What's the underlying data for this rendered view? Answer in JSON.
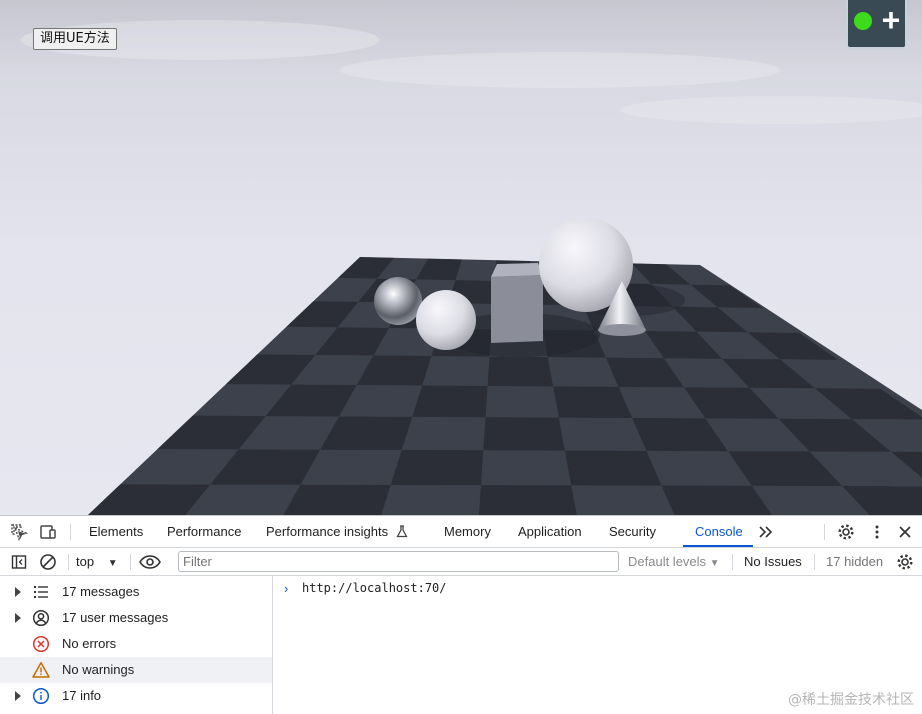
{
  "viewport": {
    "call_button_label": "调用UE方法",
    "stream_status_color": "#3ddc1b",
    "add_icon": "plus-icon"
  },
  "devtools": {
    "tabs": [
      {
        "label": "Elements"
      },
      {
        "label": "Performance"
      },
      {
        "label": "Performance insights"
      },
      {
        "label": "Memory"
      },
      {
        "label": "Application"
      },
      {
        "label": "Security"
      },
      {
        "label": "Console",
        "active": true
      }
    ],
    "accent_color": "#0b57d0",
    "context": "top",
    "filter_placeholder": "Filter",
    "levels_label": "Default levels",
    "issues_label": "No Issues",
    "hidden_label": "17 hidden",
    "sidebar": [
      {
        "label": "17 messages",
        "icon": "list-icon"
      },
      {
        "label": "17 user messages",
        "icon": "user-circle-icon"
      },
      {
        "label": "No errors",
        "icon": "error-icon"
      },
      {
        "label": "No warnings",
        "icon": "warning-icon",
        "selected": true
      },
      {
        "label": "17 info",
        "icon": "info-icon"
      }
    ],
    "console_lines": [
      "http://localhost:70/"
    ]
  },
  "watermark": "@稀土掘金技术社区"
}
